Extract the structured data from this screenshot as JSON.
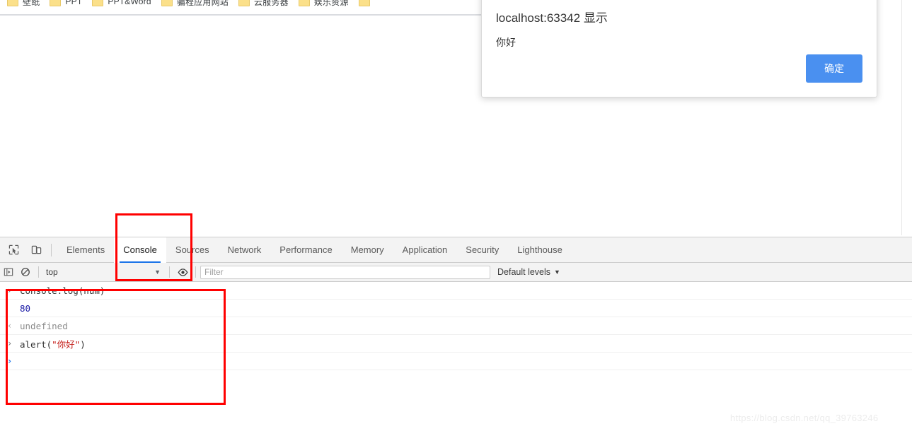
{
  "browser": {
    "bookmarks": [
      {
        "label": "壁纸",
        "icon": "folder-icon"
      },
      {
        "label": "PPT",
        "icon": "folder-icon"
      },
      {
        "label": "PPT&Word",
        "icon": "folder-icon"
      },
      {
        "label": "骗程应用网站",
        "icon": "folder-icon"
      },
      {
        "label": "云服务器",
        "icon": "folder-icon"
      },
      {
        "label": "娱乐资源",
        "icon": "folder-icon"
      }
    ]
  },
  "alert": {
    "title": "localhost:63342 显示",
    "message": "你好",
    "ok_label": "确定",
    "ok_color": "#4a90f0"
  },
  "devtools": {
    "toolbar_icons": [
      {
        "name": "inspect-element-icon"
      },
      {
        "name": "device-toolbar-icon"
      }
    ],
    "tabs": [
      {
        "label": "Elements",
        "active": false
      },
      {
        "label": "Console",
        "active": true
      },
      {
        "label": "Sources",
        "active": false
      },
      {
        "label": "Network",
        "active": false
      },
      {
        "label": "Performance",
        "active": false
      },
      {
        "label": "Memory",
        "active": false
      },
      {
        "label": "Application",
        "active": false
      },
      {
        "label": "Security",
        "active": false
      },
      {
        "label": "Lighthouse",
        "active": false
      }
    ],
    "console_toolbar": {
      "sidebar_toggle_icon": "console-sidebar-icon",
      "clear_icon": "clear-console-icon",
      "context_selector": "top",
      "context_caret": "▼",
      "live_expression_icon": "eye-icon",
      "filter_placeholder": "Filter",
      "filter_value": "",
      "levels_label": "Default levels",
      "levels_caret": "▼"
    },
    "console_rows": [
      {
        "gutter": "›",
        "gutter_type": "input",
        "text": "console.log(num)",
        "text_type": "code"
      },
      {
        "gutter": "",
        "gutter_type": "none",
        "text": "80",
        "text_type": "number"
      },
      {
        "gutter": "‹",
        "gutter_type": "output",
        "text": "undefined",
        "text_type": "undefined"
      },
      {
        "gutter": "›",
        "gutter_type": "input",
        "text": "alert(\"你好\")",
        "text_type": "string-call"
      },
      {
        "gutter": "›",
        "gutter_type": "prompt",
        "text": "",
        "text_type": "code"
      }
    ],
    "annotations": {
      "console_tab_highlight_color": "#ff0000",
      "console_output_highlight_color": "#ff0000"
    }
  },
  "watermark": "https://blog.csdn.net/qq_39763246"
}
